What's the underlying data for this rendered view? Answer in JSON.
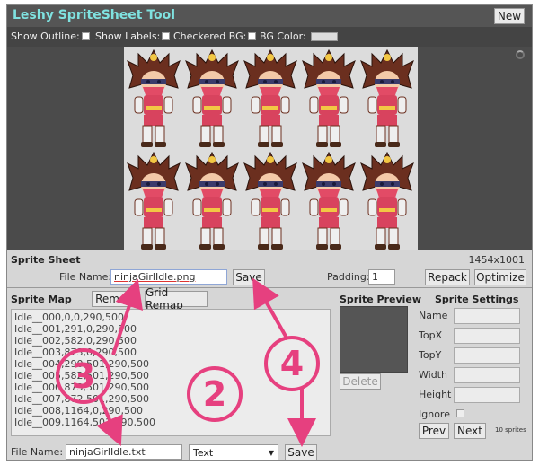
{
  "app": {
    "title": "Leshy SpriteSheet Tool",
    "new_label": "New"
  },
  "toolbar": {
    "show_outline": "Show Outline:",
    "show_labels": "Show Labels:",
    "checkered_bg": "Checkered BG:",
    "bg_color": "BG Color:"
  },
  "sprite_sheet": {
    "title": "Sprite Sheet",
    "dimensions": "1454x1001",
    "file_name_label": "File Name:",
    "file_name_value": "ninjaGirlIdle.png",
    "save_label": "Save",
    "padding_label": "Padding:",
    "padding_value": "1",
    "repack_label": "Repack",
    "optimize_label": "Optimize"
  },
  "sprite_map": {
    "title": "Sprite Map",
    "remap_label": "Remap",
    "grid_remap_label": "Grid Remap",
    "lines": [
      "Idle__000,0,0,290,500",
      "Idle__001,291,0,290,500",
      "Idle__002,582,0,290,500",
      "Idle__003,873,0,290,500",
      "Idle__004,290,501,290,500",
      "Idle__005,582,501,290,500",
      "Idle__006,873,501,290,500",
      "Idle__007,872,501,290,500",
      "Idle__008,1164,0,290,500",
      "Idle__009,1164,501,290,500"
    ],
    "file_name_label": "File Name:",
    "file_name_value": "ninjaGirlIdle.txt",
    "format_value": "Text",
    "save_label": "Save"
  },
  "sprite_preview": {
    "title": "Sprite Preview",
    "delete_label": "Delete"
  },
  "sprite_settings": {
    "title": "Sprite Settings",
    "name_label": "Name",
    "topx_label": "TopX",
    "topy_label": "TopY",
    "width_label": "Width",
    "height_label": "Height",
    "ignore_label": "Ignore",
    "prev_label": "Prev",
    "next_label": "Next",
    "count_text": "10 sprites"
  },
  "annotations": {
    "n2": "2",
    "n3": "3",
    "n4": "4"
  },
  "colors": {
    "title_accent": "#7fe2e0",
    "annotation": "#e6407f",
    "titlebar": "#555555",
    "canvas_bg": "#4b4b4b"
  }
}
